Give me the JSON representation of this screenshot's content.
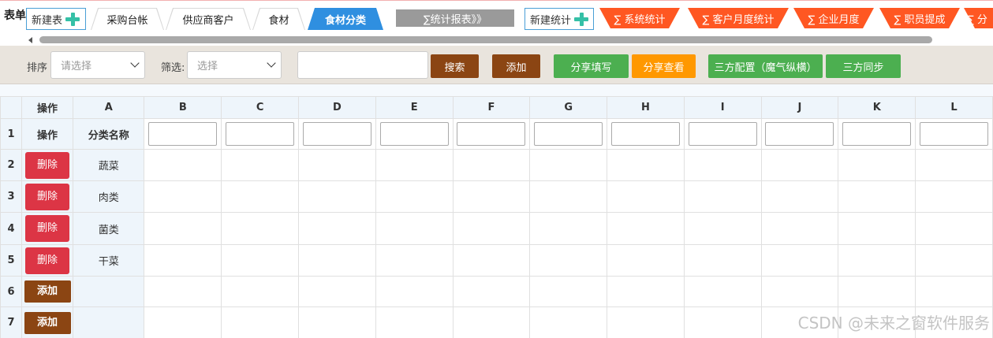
{
  "topbar": {
    "form_label": "表单",
    "new_table": "新建表",
    "tabs": [
      "采购台帐",
      "供应商客户",
      "食材",
      "食材分类"
    ],
    "stats_report": "∑统计报表》》",
    "new_stat": "新建统计",
    "stat_tabs": [
      "∑ 系统统计",
      "∑ 客户月度统计",
      "∑ 企业月度",
      "∑ 职员提成",
      "∑ 分"
    ]
  },
  "toolbar": {
    "sort_label": "排序",
    "sort_placeholder": "请选择",
    "filter_label": "筛选:",
    "filter_placeholder": "选择",
    "search_value": "",
    "search": "搜索",
    "add": "添加",
    "share_fill": "分享填写",
    "share_view": "分享查看",
    "third_config": "三方配置（魔气纵横）",
    "third_sync": "三方同步"
  },
  "grid": {
    "corner": "",
    "op_header": "操作",
    "columns": [
      "A",
      "B",
      "C",
      "D",
      "E",
      "F",
      "G",
      "H",
      "I",
      "J",
      "K",
      "L"
    ],
    "row1": {
      "num": "1",
      "op": "操作",
      "a": "分类名称"
    },
    "rows": [
      {
        "num": "2",
        "action": "删除",
        "name": "蔬菜"
      },
      {
        "num": "3",
        "action": "删除",
        "name": "肉类"
      },
      {
        "num": "4",
        "action": "删除",
        "name": "菌类"
      },
      {
        "num": "5",
        "action": "删除",
        "name": "干菜"
      },
      {
        "num": "6",
        "action": "添加",
        "name": ""
      },
      {
        "num": "7",
        "action": "添加",
        "name": ""
      }
    ]
  },
  "watermark": "CSDN @未来之窗软件服务",
  "colors": {
    "tab_active": "#2f8fe0",
    "brown": "#8b4513",
    "green": "#4caf50",
    "orange": "#ff9800",
    "red": "#dc3545",
    "stat_tab": "#ff5722"
  }
}
